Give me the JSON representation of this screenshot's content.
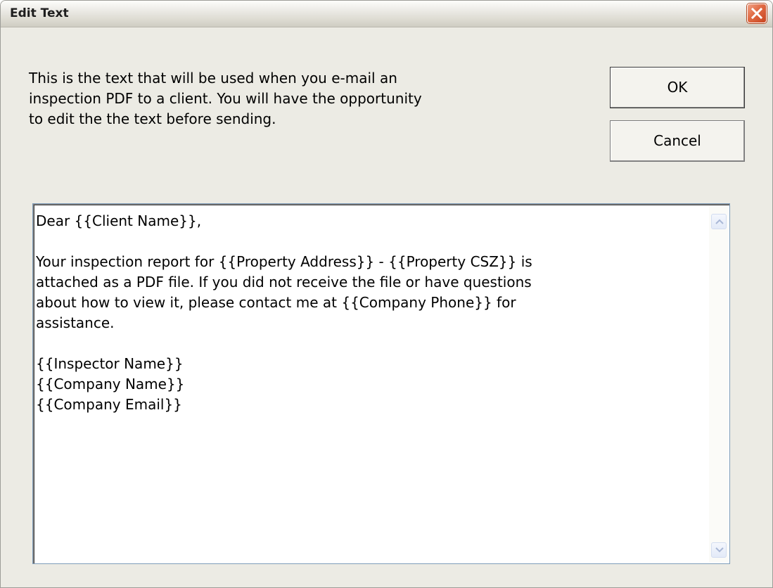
{
  "window": {
    "title": "Edit Text"
  },
  "intro": {
    "text": "This is the text that will be used when you e-mail an\ninspection PDF to a client. You will have the opportunity\nto edit the the text before sending."
  },
  "buttons": {
    "ok_label": "OK",
    "cancel_label": "Cancel"
  },
  "editor": {
    "value": "Dear {{Client Name}},\n\nYour inspection report for {{Property Address}} - {{Property CSZ}} is\nattached as a PDF file. If you did not receive the file or have questions\nabout how to view it, please contact me at {{Company Phone}} for\nassistance.\n\n{{Inspector Name}}\n{{Company Name}}\n{{Company Email}}"
  },
  "icons": {
    "close": "close-icon",
    "scroll_up": "chevron-up-icon",
    "scroll_down": "chevron-down-icon"
  },
  "colors": {
    "window_bg": "#ecebe4",
    "close_button": "#e06a43",
    "editor_border": "#7f9db9"
  }
}
